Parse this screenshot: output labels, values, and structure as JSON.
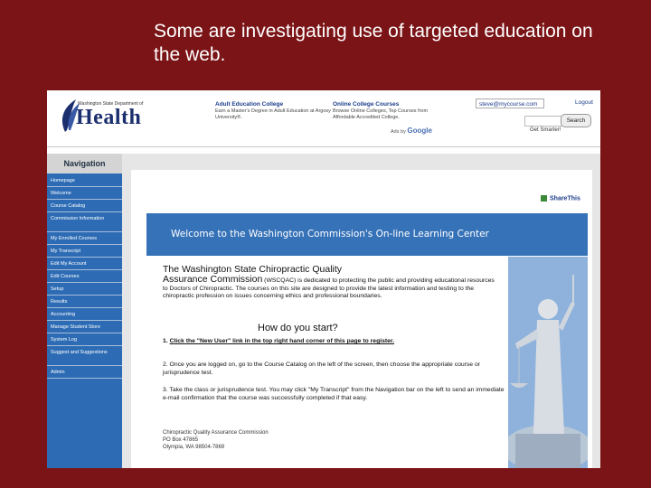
{
  "slide": {
    "title": "Some are investigating use of targeted education on the web."
  },
  "header": {
    "logo_subtitle": "Washington State Department of",
    "logo_text": "Health",
    "ads": [
      {
        "title": "Adult Education College",
        "text": "Earn a Master's Degree in Adult Education at Argosy University®."
      },
      {
        "title": "Online College Courses",
        "text": "Browse Online Colleges, Top Courses from Affordable Accredited College."
      }
    ],
    "ads_by_prefix": "Ads by",
    "ads_by_brand": "Google",
    "email": "steve@mycourse.com",
    "logout_label": "Logout",
    "search_label": "Search",
    "tagline": "Get Smarter!"
  },
  "nav": {
    "heading": "Navigation",
    "items": [
      "Homepage",
      "Welcome",
      "Course Catalog",
      "Commission Information",
      "My Enrolled Courses",
      "My Transcript",
      "Edit My Account",
      "Edit Courses",
      "Setup",
      "Results",
      "Accounting",
      "Manage Student Store",
      "System Log",
      "Suggest and Suggestions",
      "Admin"
    ]
  },
  "main": {
    "share_label": "ShareThis",
    "banner": "Welcome to the Washington Commission's On-line Learning Center",
    "org_title_line1": "The Washington State Chiropractic Quality",
    "org_title_line2": "Assurance Commission",
    "intro_text": " (WSCQAC) is dedicated to protecting the public and providing educational resources to Doctors of Chiropractic. The courses on this site are designed to provide the latest information and testing to the chiropractic profession on issues concerning ethics and professional boundaries.",
    "how_heading": "How do you start?",
    "step1_prefix": "1. ",
    "step1_link": "Click the \"New User\" link in the top right hand corner of this page to register.",
    "step2": "2. Once you are logged on, go to the Course Catalog on the left of the screen, then choose the appropriate course or jurisprudence test.",
    "step3": "3. Take the class or jurisprudence test. You may click \"My Transcript\" from the Navigation bar on the left to send an immediate e-mail confirmation that the course was successfully completed if that easy.",
    "address": [
      "Chiropractic Quality Assurance Commission",
      "PO Box 47865",
      "Olympia, WA 98504-7869"
    ]
  },
  "colors": {
    "slide_background": "#7b1416",
    "nav_blue": "#2d6cb5",
    "banner_blue": "#3672b8",
    "logo_navy": "#1b2f6e"
  }
}
